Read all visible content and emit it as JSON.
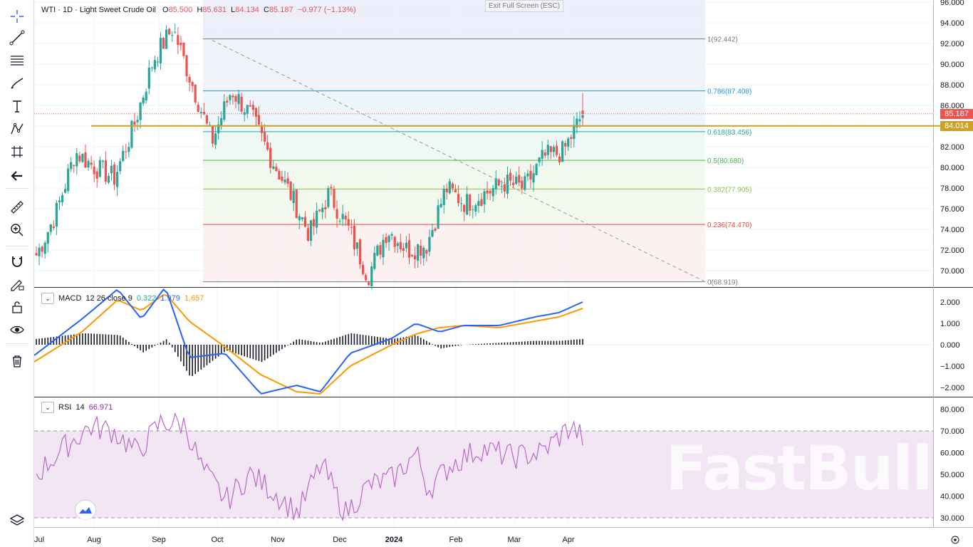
{
  "header": {
    "symbol": "WTI",
    "interval": "1D",
    "name": "Light Sweet Crude Oil",
    "open_label": "O",
    "open": "85.500",
    "high_label": "H",
    "high": "85.631",
    "low_label": "L",
    "low": "84.134",
    "close_label": "C",
    "close": "85.187",
    "change": "−0.977 (−1.13%)"
  },
  "exit_fullscreen": "Exit Full Screen (ESC)",
  "price_tags": {
    "last": "85.187",
    "horizontal_line": "84.014"
  },
  "toolbar": {
    "icons": [
      "crosshair-icon",
      "trend-line-icon",
      "fib-lines-icon",
      "brush-icon",
      "text-icon",
      "pattern-icon",
      "forecast-icon",
      "back-arrow-icon",
      "ruler-icon",
      "zoom-in-icon",
      "magnet-icon",
      "pencil-lock-icon",
      "lock-icon",
      "eye-icon",
      "trash-icon",
      "layers-icon"
    ]
  },
  "colors": {
    "up": "#26a69a",
    "down": "#ef5350",
    "macd": "#2962ff",
    "signal": "#ff9800",
    "rsi": "#9c27b0",
    "hline": "#c9a227"
  },
  "panes": {
    "macd": {
      "label": "MACD",
      "params": "12 26 close 9",
      "hist": "0.322",
      "macd": "1.979",
      "signal": "1.657"
    },
    "rsi": {
      "label": "RSI",
      "params": "14",
      "value": "66.971"
    }
  },
  "watermark": "FastBull",
  "chart_data": {
    "type": "candlestick",
    "title": "WTI · 1D · Light Sweet Crude Oil",
    "x_labels": [
      "Jul",
      "Aug",
      "Sep",
      "Oct",
      "Nov",
      "Dec",
      "2024",
      "Feb",
      "Mar",
      "Apr"
    ],
    "price_axis": {
      "ylim": [
        69.0,
        96.0
      ],
      "ticks": [
        "70.000",
        "72.000",
        "74.000",
        "76.000",
        "78.000",
        "80.000",
        "82.000",
        "84.000",
        "86.000",
        "88.000",
        "90.000",
        "92.000",
        "94.000",
        "96.000"
      ]
    },
    "last_price": 85.187,
    "horizontal_line": 84.014,
    "fibonacci": [
      {
        "label": "1(92.442)",
        "value": 92.442,
        "color": "#787b86"
      },
      {
        "label": "0.786(87.408)",
        "value": 87.408,
        "color": "#2196f3"
      },
      {
        "label": "0.618(83.456)",
        "value": 83.456,
        "color": "#26a69a"
      },
      {
        "label": "0.5(80.680)",
        "value": 80.68,
        "color": "#4caf50"
      },
      {
        "label": "0.382(77.905)",
        "value": 77.905,
        "color": "#8bc34a"
      },
      {
        "label": "0.236(74.470)",
        "value": 74.47,
        "color": "#f44336"
      },
      {
        "label": "0(68.919)",
        "value": 68.919,
        "color": "#787b86"
      }
    ],
    "trend_line": {
      "from": [
        92.3,
        "late Sep"
      ],
      "to": [
        69.0,
        "mid Apr"
      ]
    },
    "close_path": [
      [
        "Jul",
        71.5
      ],
      [
        "mid Jul",
        75.5
      ],
      [
        "Aug",
        81.5
      ],
      [
        "mid Aug",
        80.0
      ],
      [
        "late Aug",
        79.0
      ],
      [
        "Sep",
        84.0
      ],
      [
        "mid Sep",
        90.5
      ],
      [
        "late Sep",
        93.5
      ],
      [
        "Oct",
        88.0
      ],
      [
        "early Oct",
        82.5
      ],
      [
        "mid Oct",
        87.5
      ],
      [
        "late Oct",
        85.0
      ],
      [
        "Nov",
        81.0
      ],
      [
        "early Nov",
        77.5
      ],
      [
        "mid Nov",
        73.5
      ],
      [
        "late Nov",
        77.5
      ],
      [
        "Dec",
        74.0
      ],
      [
        "mid Dec",
        69.5
      ],
      [
        "late Dec",
        74.0
      ],
      [
        "2024",
        72.0
      ],
      [
        "mid Jan",
        72.5
      ],
      [
        "late Jan",
        78.0
      ],
      [
        "Feb",
        76.5
      ],
      [
        "mid Feb",
        77.5
      ],
      [
        "late Feb",
        78.5
      ],
      [
        "Mar",
        78.0
      ],
      [
        "mid Mar",
        81.0
      ],
      [
        "late Mar",
        81.5
      ],
      [
        "Apr",
        85.2
      ]
    ],
    "macd_axis": {
      "ticks": [
        "2.000",
        "1.000",
        "0.000",
        "−1.000",
        "−2.000"
      ]
    },
    "rsi_axis": {
      "ticks": [
        "80.000",
        "70.000",
        "60.000",
        "50.000",
        "40.000",
        "30.000"
      ],
      "bands": [
        30,
        70
      ]
    },
    "rsi_path": [
      [
        0,
        50
      ],
      [
        5,
        63
      ],
      [
        9,
        72
      ],
      [
        13,
        70
      ],
      [
        17,
        60
      ],
      [
        21,
        74
      ],
      [
        25,
        73
      ],
      [
        28,
        52
      ],
      [
        32,
        38
      ],
      [
        36,
        50
      ],
      [
        40,
        42
      ],
      [
        44,
        32
      ],
      [
        48,
        55
      ],
      [
        52,
        32
      ],
      [
        56,
        45
      ],
      [
        60,
        48
      ],
      [
        64,
        60
      ],
      [
        66,
        43
      ],
      [
        70,
        55
      ],
      [
        75,
        62
      ],
      [
        80,
        58
      ],
      [
        85,
        60
      ],
      [
        90,
        72
      ],
      [
        92,
        67
      ]
    ],
    "macd_path": [
      [
        0,
        -0.5
      ],
      [
        8,
        1.2
      ],
      [
        14,
        2.6
      ],
      [
        18,
        1.2
      ],
      [
        22,
        2.7
      ],
      [
        26,
        -0.6
      ],
      [
        32,
        -0.4
      ],
      [
        38,
        -2.3
      ],
      [
        44,
        -1.9
      ],
      [
        48,
        -2.2
      ],
      [
        53,
        -0.4
      ],
      [
        60,
        0.3
      ],
      [
        64,
        1.0
      ],
      [
        68,
        0.6
      ],
      [
        72,
        0.9
      ],
      [
        78,
        0.9
      ],
      [
        84,
        1.3
      ],
      [
        88,
        1.5
      ],
      [
        92,
        2.0
      ]
    ],
    "signal_path": [
      [
        0,
        -0.8
      ],
      [
        8,
        0.6
      ],
      [
        14,
        2.1
      ],
      [
        18,
        1.6
      ],
      [
        22,
        2.4
      ],
      [
        26,
        1.1
      ],
      [
        32,
        -0.1
      ],
      [
        38,
        -1.4
      ],
      [
        44,
        -2.2
      ],
      [
        48,
        -2.3
      ],
      [
        53,
        -1.0
      ],
      [
        60,
        0.0
      ],
      [
        64,
        0.5
      ],
      [
        68,
        0.8
      ],
      [
        72,
        0.9
      ],
      [
        78,
        0.8
      ],
      [
        84,
        1.1
      ],
      [
        88,
        1.3
      ],
      [
        92,
        1.7
      ]
    ]
  }
}
